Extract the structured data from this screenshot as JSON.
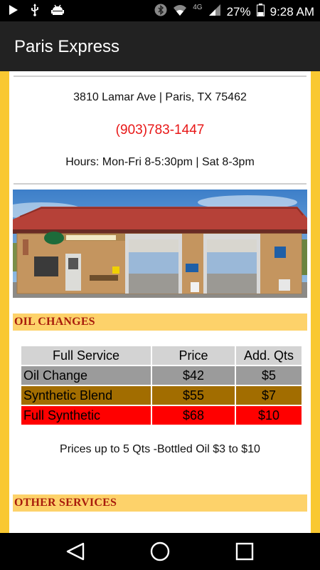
{
  "status_bar": {
    "battery_percent": "27%",
    "time": "9:28 AM",
    "network_label": "4G",
    "icons": [
      "play-icon",
      "usb-icon",
      "android-debug-icon",
      "bluetooth-icon",
      "wifi-icon",
      "signal-icon",
      "battery-icon"
    ]
  },
  "app_bar": {
    "title": "Paris Express"
  },
  "location": {
    "address": "3810 Lamar Ave | Paris, TX 75462",
    "phone": "(903)783-1447",
    "hours": "Hours: Mon-Fri 8-5:30pm | Sat 8-3pm"
  },
  "oil_changes": {
    "heading": "OIL CHANGES",
    "columns": [
      "Full Service",
      "Price",
      "Add. Qts"
    ],
    "rows": [
      {
        "name": "Oil Change",
        "price": "$42",
        "add_qts": "$5",
        "color": "#9b9b9b"
      },
      {
        "name": "Synthetic Blend",
        "price": "$55",
        "add_qts": "$7",
        "color": "#a26d00"
      },
      {
        "name": "Full Synthetic",
        "price": "$68",
        "add_qts": "$10",
        "color": "#ff0000"
      }
    ],
    "note": "Prices up to 5 Qts -Bottled Oil $3 to $10"
  },
  "other_services": {
    "heading": "OTHER SERVICES"
  },
  "colors": {
    "accent_yellow": "#f9c831",
    "banner_fill": "#fdd26a",
    "heading_red": "#a81c0c",
    "phone_red": "#e81717",
    "app_bar": "#222222"
  },
  "nav_bar": {
    "buttons": [
      "back-icon",
      "home-icon",
      "recents-icon"
    ]
  }
}
